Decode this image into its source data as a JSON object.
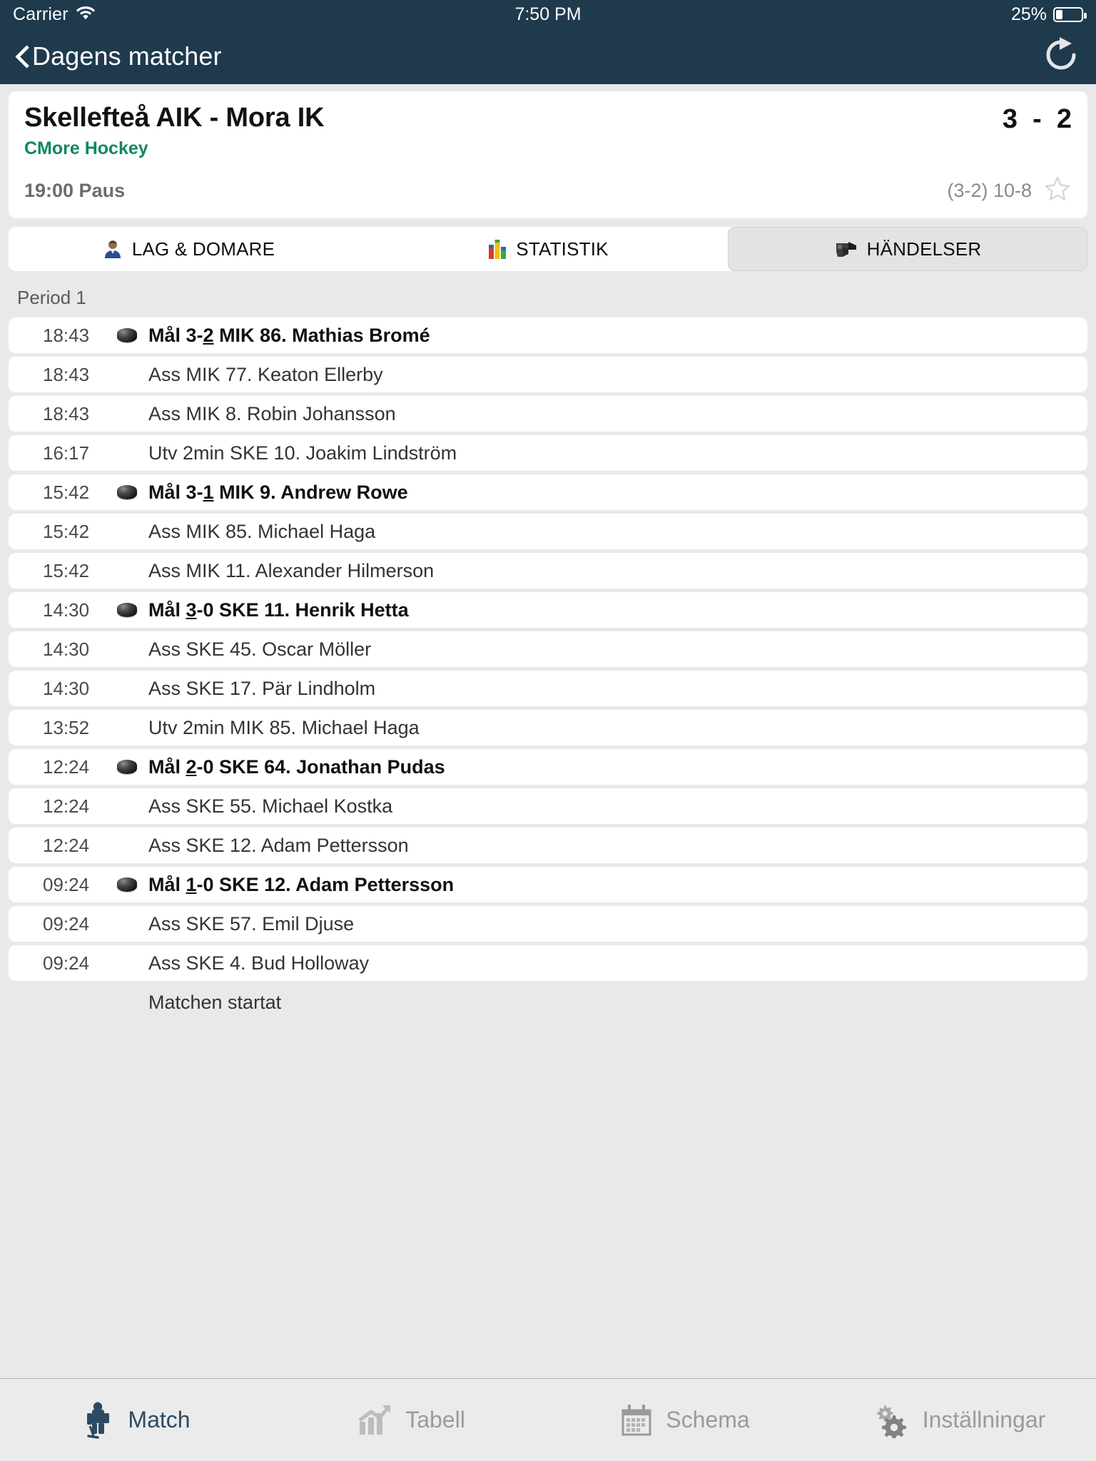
{
  "statusbar": {
    "carrier": "Carrier",
    "time": "7:50 PM",
    "battery_percent": "25%",
    "battery_level": 25,
    "wifi_icon": "wifi-icon",
    "battery_icon": "battery-icon"
  },
  "navbar": {
    "back_label": "Dagens matcher",
    "back_icon": "chevron-left-icon",
    "refresh_icon": "refresh-icon",
    "background_color": "#1f3a4d"
  },
  "match": {
    "title": "Skellefteå AIK - Mora IK",
    "score": "3  -  2",
    "channel": "CMore Hockey",
    "channel_color": "#10885c",
    "status": "19:00 Paus",
    "period_scores": "(3-2) 10-8",
    "favorite_icon": "star-outline-icon"
  },
  "tabs": [
    {
      "label": "LAG & DOMARE",
      "icon": "person-icon",
      "active": false
    },
    {
      "label": "STATISTIK",
      "icon": "bar-chart-icon",
      "active": false
    },
    {
      "label": "HÄNDELSER",
      "icon": "whistle-icon",
      "active": true
    }
  ],
  "events": {
    "period_label": "Period 1",
    "rows": [
      {
        "time": "18:43",
        "icon": "puck-icon",
        "type": "goal",
        "prefix": "Mål 3-",
        "underline": "2",
        "suffix": " MIK 86. Mathias Bromé"
      },
      {
        "time": "18:43",
        "icon": "",
        "type": "assist",
        "text": "Ass MIK 77. Keaton Ellerby"
      },
      {
        "time": "18:43",
        "icon": "",
        "type": "assist",
        "text": "Ass MIK 8. Robin Johansson"
      },
      {
        "time": "16:17",
        "icon": "",
        "type": "penalty",
        "text": "Utv 2min SKE 10. Joakim Lindström"
      },
      {
        "time": "15:42",
        "icon": "puck-icon",
        "type": "goal",
        "prefix": "Mål 3-",
        "underline": "1",
        "suffix": " MIK 9. Andrew Rowe"
      },
      {
        "time": "15:42",
        "icon": "",
        "type": "assist",
        "text": "Ass MIK 85. Michael Haga"
      },
      {
        "time": "15:42",
        "icon": "",
        "type": "assist",
        "text": "Ass MIK 11. Alexander Hilmerson"
      },
      {
        "time": "14:30",
        "icon": "puck-icon",
        "type": "goal",
        "prefix": "Mål ",
        "underline": "3",
        "suffix": "-0 SKE 11. Henrik Hetta"
      },
      {
        "time": "14:30",
        "icon": "",
        "type": "assist",
        "text": "Ass SKE 45. Oscar Möller"
      },
      {
        "time": "14:30",
        "icon": "",
        "type": "assist",
        "text": "Ass SKE 17. Pär Lindholm"
      },
      {
        "time": "13:52",
        "icon": "",
        "type": "penalty",
        "text": "Utv 2min MIK 85. Michael Haga"
      },
      {
        "time": "12:24",
        "icon": "puck-icon",
        "type": "goal",
        "prefix": "Mål ",
        "underline": "2",
        "suffix": "-0 SKE 64. Jonathan Pudas"
      },
      {
        "time": "12:24",
        "icon": "",
        "type": "assist",
        "text": "Ass SKE 55. Michael Kostka"
      },
      {
        "time": "12:24",
        "icon": "",
        "type": "assist",
        "text": "Ass SKE 12. Adam Pettersson"
      },
      {
        "time": "09:24",
        "icon": "puck-icon",
        "type": "goal",
        "prefix": "Mål ",
        "underline": "1",
        "suffix": "-0 SKE 12. Adam Pettersson"
      },
      {
        "time": "09:24",
        "icon": "",
        "type": "assist",
        "text": "Ass SKE 57. Emil Djuse"
      },
      {
        "time": "09:24",
        "icon": "",
        "type": "assist",
        "text": "Ass SKE 4. Bud Holloway"
      },
      {
        "time": "",
        "icon": "",
        "type": "note",
        "text": "Matchen startat"
      }
    ]
  },
  "tabbar": [
    {
      "label": "Match",
      "icon": "goalie-icon",
      "active": true
    },
    {
      "label": "Tabell",
      "icon": "chart-up-icon",
      "active": false
    },
    {
      "label": "Schema",
      "icon": "calendar-icon",
      "active": false
    },
    {
      "label": "Inställningar",
      "icon": "gears-icon",
      "active": false
    }
  ]
}
